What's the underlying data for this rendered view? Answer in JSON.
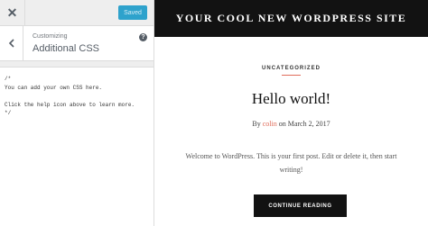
{
  "customizer": {
    "close_icon": "close-icon",
    "saved_label": "Saved",
    "back_icon": "chevron-left-icon",
    "customizing_label": "Customizing",
    "section_title": "Additional CSS",
    "help_icon": "help-icon",
    "css_value": "/*\nYou can add your own CSS here.\n\nClick the help icon above to learn more.\n*/",
    "colors": {
      "accent": "#2ea2cc"
    }
  },
  "preview": {
    "site_title": "YOUR COOL NEW WORDPRESS SITE",
    "post": {
      "category": "UNCATEGORIZED",
      "title": "Hello world!",
      "meta_by": "By",
      "author": "colin",
      "meta_on": "on",
      "date": "March 2, 2017",
      "excerpt": "Welcome to WordPress. This is your first post. Edit or delete it, then start writing!",
      "read_more": "CONTINUE READING"
    },
    "colors": {
      "header": "#121212",
      "link": "#e06d5b"
    }
  }
}
